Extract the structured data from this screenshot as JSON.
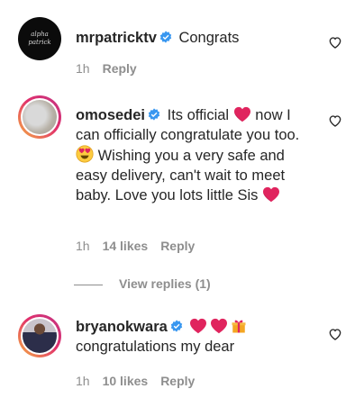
{
  "comments": [
    {
      "username": "mrpatricktv",
      "text_parts": [
        "Congrats"
      ],
      "time": "1h",
      "likes": "",
      "reply_label": "Reply",
      "avatar_logo_text": "alpha patrick"
    },
    {
      "username": "omosedei",
      "text_parts": [
        "Its official ",
        " now I can officially congratulate you too.",
        " Wishing you a very safe and easy delivery, can't wait to meet baby. Love you lots little Sis "
      ],
      "time": "1h",
      "likes": "14 likes",
      "reply_label": "Reply"
    },
    {
      "username": "bryanokwara",
      "text_parts": [
        "congratulations my dear"
      ],
      "time": "1h",
      "likes": "10 likes",
      "reply_label": "Reply"
    }
  ],
  "view_replies": "View replies (1)",
  "colors": {
    "verified": "#3897f0",
    "heart": "#e0245e",
    "muted": "#8e8e8e",
    "text": "#262626"
  },
  "icons": {
    "like": "heart-outline-icon",
    "verified": "verified-badge-icon"
  }
}
